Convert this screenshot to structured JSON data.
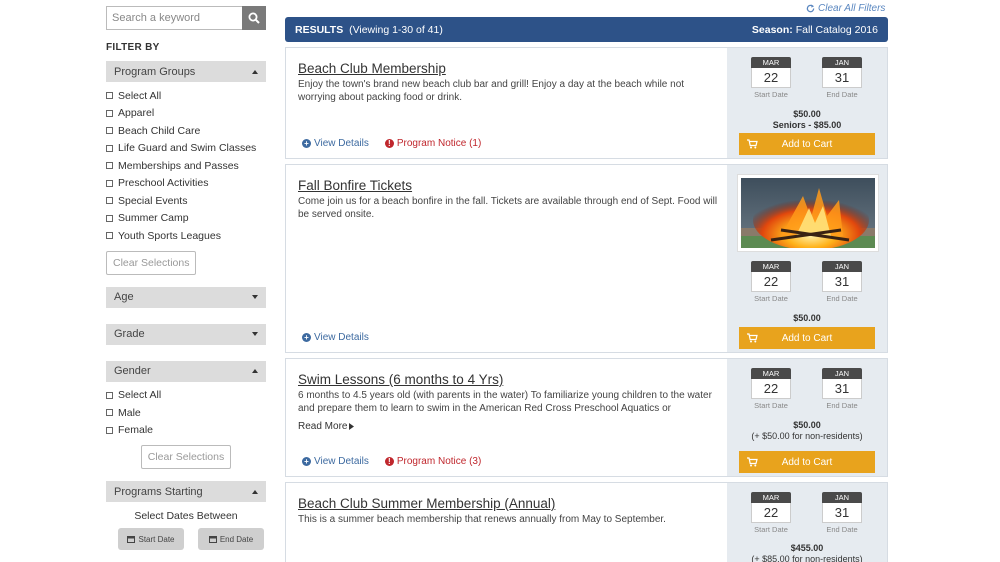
{
  "search": {
    "placeholder": "Search a keyword"
  },
  "filter_by_label": "FILTER BY",
  "program_groups": {
    "title": "Program Groups",
    "options": [
      "Select All",
      "Apparel",
      "Beach Child Care",
      "Life Guard and Swim Classes",
      "Memberships and Passes",
      "Preschool Activities",
      "Special Events",
      "Summer Camp",
      "Youth Sports Leagues"
    ],
    "clear_label": "Clear Selections"
  },
  "age": {
    "title": "Age"
  },
  "grade": {
    "title": "Grade"
  },
  "gender": {
    "title": "Gender",
    "options": [
      "Select All",
      "Male",
      "Female"
    ],
    "clear_label": "Clear Selections"
  },
  "programs_starting": {
    "title": "Programs Starting",
    "select_dates_label": "Select Dates Between",
    "start_label": "Start Date",
    "end_label": "End Date"
  },
  "clear_all_filters": "Clear All Filters",
  "results": {
    "label": "RESULTS",
    "viewing": "(Viewing 1-30 of 41)",
    "season_label": "Season:",
    "season_value": "Fall Catalog 2016"
  },
  "start_date_caption": "Start Date",
  "end_date_caption": "End Date",
  "view_details_label": "View Details",
  "add_to_cart_label": "Add to Cart",
  "read_more_label": "Read More",
  "programs": [
    {
      "title": "Beach Club Membership",
      "description": "Enjoy the town's brand new beach club bar and grill! Enjoy a day at the beach while not worrying about packing food or drink.",
      "start": {
        "month": "MAR",
        "day": "22"
      },
      "end": {
        "month": "JAN",
        "day": "31"
      },
      "price": "$50.00",
      "price_sub": "Seniors - $85.00",
      "notice": "Program Notice (1)"
    },
    {
      "title": "Fall Bonfire Tickets",
      "description": "Come join us for a beach bonfire in the fall. Tickets are available through end of Sept. Food will be served onsite.",
      "start": {
        "month": "MAR",
        "day": "22"
      },
      "end": {
        "month": "JAN",
        "day": "31"
      },
      "price": "$50.00"
    },
    {
      "title": "Swim Lessons (6 months to 4 Yrs)",
      "description": "6 months to 4.5 years old (with parents in the water) To familiarize young children to the water and prepare them to learn to swim in the American Red Cross Preschool Aquatics or",
      "start": {
        "month": "MAR",
        "day": "22"
      },
      "end": {
        "month": "JAN",
        "day": "31"
      },
      "price": "$50.00",
      "price_sub": "(+ $50.00 for non-residents)",
      "notice": "Program Notice (3)"
    },
    {
      "title": "Beach Club Summer Membership (Annual)",
      "description": "This is a summer beach membership that renews annually from May to September.",
      "start": {
        "month": "MAR",
        "day": "22"
      },
      "end": {
        "month": "JAN",
        "day": "31"
      },
      "price": "$455.00",
      "price_sub": "(+ $85.00 for non-residents)"
    }
  ],
  "colors": {
    "header": "#2d5288",
    "cart": "#e8a31d",
    "notice": "#c0272d",
    "link": "#3d6aa0"
  },
  "icons": [
    "search-icon",
    "refresh-icon",
    "plus-circle-icon",
    "exclamation-circle-icon",
    "cart-icon",
    "calendar-icon",
    "caret-icon"
  ]
}
